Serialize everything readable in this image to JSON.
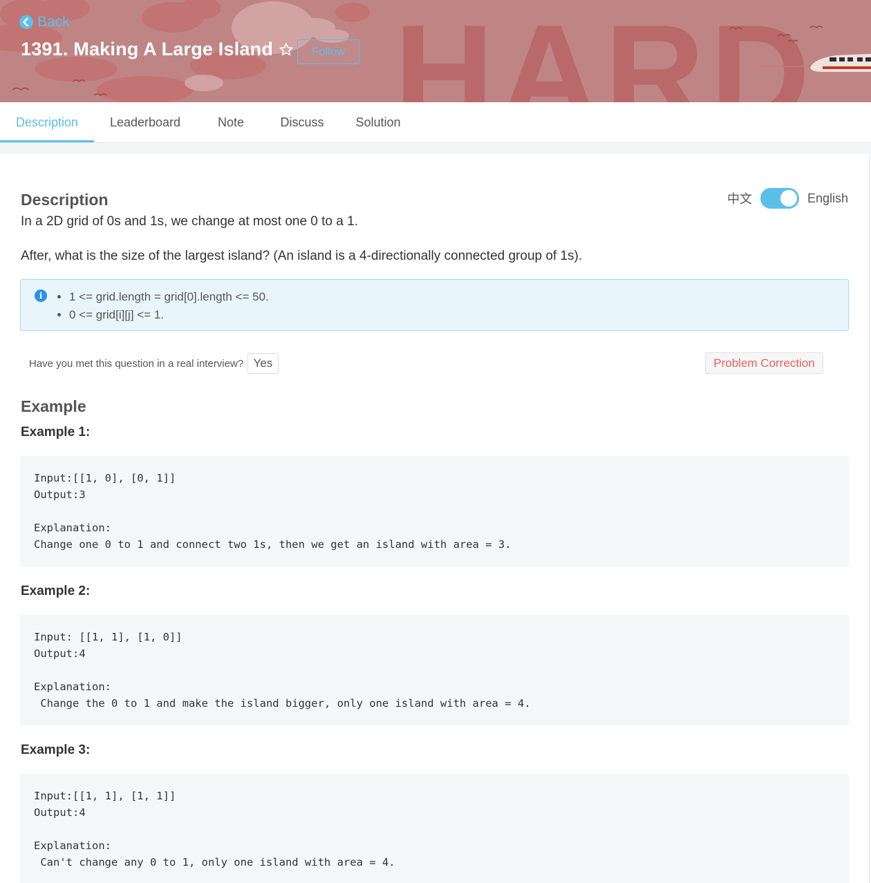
{
  "header": {
    "back_label": "Back",
    "title": "1391. Making A Large Island",
    "follow_label": "Follow",
    "difficulty_watermark": "HARD",
    "icons": {
      "back": "back-circle-icon",
      "star": "star-outline-icon"
    },
    "colors": {
      "banner": "#bf8585",
      "accent": "#5bc0e8"
    }
  },
  "tabs": [
    {
      "label": "Description",
      "active": true
    },
    {
      "label": "Leaderboard",
      "active": false
    },
    {
      "label": "Note",
      "active": false
    },
    {
      "label": "Discuss",
      "active": false
    },
    {
      "label": "Solution",
      "active": false
    }
  ],
  "description": {
    "heading": "Description",
    "lang_cn": "中文",
    "lang_en": "English",
    "paragraph1": "In a 2D grid of 0s and 1s, we change at most one 0 to a 1.",
    "paragraph2": "After, what is the size of the largest island? (An island is a 4-directionally connected group of 1s).",
    "constraints": [
      "1 <= grid.length = grid[0].length <= 50.",
      "0 <= grid[i][j] <= 1."
    ],
    "info_icon_glyph": "i",
    "interview_question": "Have you met this question in a real interview?",
    "yes_label": "Yes",
    "correction_label": "Problem Correction"
  },
  "examples": {
    "heading": "Example",
    "items": [
      {
        "title": "Example 1:",
        "lines": [
          "Input:[[1, 0], [0, 1]]",
          "Output:3",
          "",
          "Explanation:",
          "Change one 0 to 1 and connect two 1s, then we get an island with area = 3."
        ]
      },
      {
        "title": "Example 2:",
        "lines": [
          "Input: [[1, 1], [1, 0]]",
          "Output:4",
          "",
          "Explanation:",
          " Change the 0 to 1 and make the island bigger, only one island with area = 4."
        ]
      },
      {
        "title": "Example 3:",
        "lines": [
          "Input:[[1, 1], [1, 1]]",
          "Output:4",
          "",
          "Explanation:",
          " Can't change any 0 to 1, only one island with area = 4."
        ]
      }
    ]
  }
}
